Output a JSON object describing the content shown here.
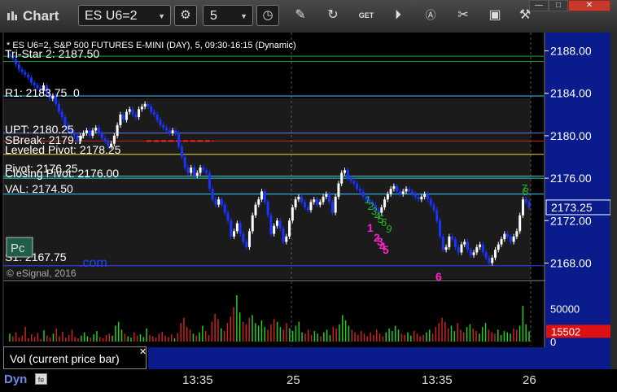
{
  "toolbar": {
    "app_title": "Chart",
    "symbol": "ES U6=2",
    "interval": "5",
    "icons": [
      "link-icon",
      "interval-refresh-icon",
      "clock-icon",
      "pencil-icon",
      "refresh-icon",
      "get-icon",
      "play-icon",
      "auto-icon",
      "tools-icon",
      "message-icon",
      "settings-icon"
    ],
    "window_buttons": [
      "minimize",
      "maximize",
      "close"
    ]
  },
  "chart_header": "* ES U6=2, S&P 500 FUTURES E-MINI (DAY), 5, 09:30-16:15 (Dynamic)",
  "copyright": "© eSignal, 2016",
  "watermark_left": "Pc",
  "watermark_com": ".com",
  "price_axis": {
    "ticks": [
      "2188.00",
      "2184.00",
      "2180.00",
      "2176.00",
      "2172.00",
      "2168.00"
    ],
    "current_price": "2173.25"
  },
  "level_labels": [
    {
      "text": "Tri-Star 2: 2187.50",
      "value": 2187.5,
      "color": "#22aa33"
    },
    {
      "text": "R1: 2183.75",
      "value": 2183.75,
      "color": "#33c8ff"
    },
    {
      "text": "UPT: 2180.25",
      "value": 2180.25,
      "color": "#6677ff"
    },
    {
      "text": "Leveled Pivot: 2178.25",
      "value": 2178.25,
      "color": "#eedd22"
    },
    {
      "text": "Closing Pivot: 2176.00",
      "value": 2176.0,
      "color": "#33c8c8"
    },
    {
      "text": "VAL: 2174.50",
      "value": 2174.5,
      "color": "#33c8ff"
    },
    {
      "text": "S1: 2167.75",
      "value": 2167.75,
      "color": "#3344ff"
    }
  ],
  "overlapped_label_fragments": [
    "0",
    "SBreak: 2179.7",
    "Pivot: 2176.25"
  ],
  "extra_lines": [
    {
      "value": 2187.0,
      "color": "#22aa33"
    },
    {
      "value": 2179.5,
      "color": "#cc2222"
    },
    {
      "value": 2176.2,
      "color": "#33c8c8"
    }
  ],
  "volume_axis": {
    "ticks": [
      "50000",
      "0"
    ],
    "current_volume": "15502"
  },
  "volume_panel_label": "Vol (current price bar)",
  "time_axis": [
    "13:35",
    "25",
    "13:35",
    "26"
  ],
  "bottom_left_label": "Dyn",
  "annotations": {
    "magenta": [
      "1",
      "2",
      "3",
      "4",
      "5",
      "6"
    ],
    "green": [
      "1",
      "2",
      "3",
      "4",
      "5",
      "6",
      "7",
      "8",
      "9"
    ]
  },
  "chart_data": {
    "type": "candlestick",
    "title": "* ES U6=2, S&P 500 FUTURES E-MINI (DAY), 5, 09:30-16:15 (Dynamic)",
    "ylim": [
      2166.5,
      2189.5
    ],
    "volume_ylim": [
      0,
      70000
    ],
    "closes": [
      2187.5,
      2187.25,
      2186.75,
      2186.25,
      2186.0,
      2185.75,
      2185.5,
      2185.0,
      2184.75,
      2184.5,
      2184.25,
      2184.75,
      2184.0,
      2183.5,
      2183.75,
      2183.0,
      2182.25,
      2181.75,
      2181.0,
      2180.5,
      2180.25,
      2180.0,
      2179.5,
      2180.0,
      2180.25,
      2180.5,
      2180.0,
      2180.5,
      2180.75,
      2180.25,
      2179.75,
      2179.5,
      2179.0,
      2179.25,
      2180.0,
      2181.0,
      2182.0,
      2181.5,
      2182.25,
      2182.5,
      2182.0,
      2181.75,
      2182.5,
      2182.75,
      2183.0,
      2182.75,
      2182.25,
      2182.0,
      2181.5,
      2181.0,
      2180.75,
      2180.5,
      2180.25,
      2180.5,
      2180.25,
      2179.0,
      2178.0,
      2177.0,
      2176.5,
      2177.0,
      2176.25,
      2176.5,
      2177.0,
      2176.75,
      2176.5,
      2175.0,
      2174.0,
      2173.5,
      2174.0,
      2173.5,
      2172.75,
      2172.0,
      2170.5,
      2171.0,
      2171.75,
      2170.75,
      2170.0,
      2169.5,
      2171.0,
      2172.5,
      2173.5,
      2174.0,
      2174.75,
      2173.75,
      2172.5,
      2170.75,
      2171.5,
      2172.0,
      2171.25,
      2170.0,
      2170.5,
      2172.0,
      2173.25,
      2174.0,
      2174.25,
      2173.75,
      2173.25,
      2173.0,
      2173.75,
      2174.0,
      2173.5,
      2173.75,
      2174.25,
      2174.5,
      2173.75,
      2172.75,
      2174.25,
      2175.5,
      2176.5,
      2176.75,
      2176.0,
      2175.75,
      2175.5,
      2175.0,
      2174.75,
      2174.25,
      2174.0,
      2173.75,
      2173.5,
      2173.0,
      2172.75,
      2173.25,
      2174.0,
      2174.5,
      2175.0,
      2175.25,
      2174.75,
      2174.5,
      2174.75,
      2175.0,
      2174.75,
      2174.5,
      2174.25,
      2174.0,
      2174.25,
      2174.5,
      2174.0,
      2173.5,
      2173.0,
      2172.0,
      2170.5,
      2169.25,
      2169.5,
      2170.5,
      2170.25,
      2169.5,
      2169.0,
      2169.75,
      2170.0,
      2169.25,
      2168.75,
      2169.0,
      2169.5,
      2169.75,
      2169.0,
      2168.5,
      2168.0,
      2168.5,
      2169.25,
      2169.75,
      2170.25,
      2170.75,
      2170.5,
      2170.0,
      2170.5,
      2171.0,
      2172.5,
      2174.0,
      2173.75,
      2173.25
    ],
    "volumes": [
      12000,
      8000,
      14000,
      6000,
      9000,
      22000,
      5000,
      11000,
      7000,
      13000,
      4000,
      17000,
      9000,
      6000,
      12000,
      20000,
      8000,
      15000,
      6000,
      10000,
      18000,
      7000,
      5000,
      9000,
      14000,
      8000,
      6000,
      11000,
      16000,
      7000,
      5000,
      10000,
      12000,
      9000,
      24000,
      30000,
      18000,
      12000,
      8000,
      6000,
      14000,
      9000,
      11000,
      7000,
      20000,
      10000,
      8000,
      6000,
      12000,
      15000,
      9000,
      7000,
      11000,
      5000,
      13000,
      28000,
      36000,
      22000,
      18000,
      12000,
      9000,
      14000,
      24000,
      16000,
      10000,
      30000,
      42000,
      34000,
      20000,
      16000,
      28000,
      38000,
      52000,
      70000,
      44000,
      30000,
      26000,
      36000,
      40000,
      28000,
      24000,
      32000,
      22000,
      18000,
      26000,
      34000,
      30000,
      22000,
      18000,
      28000,
      20000,
      16000,
      24000,
      30000,
      14000,
      12000,
      18000,
      10000,
      16000,
      12000,
      8000,
      14000,
      18000,
      10000,
      22000,
      20000,
      26000,
      40000,
      32000,
      24000,
      18000,
      14000,
      10000,
      16000,
      12000,
      8000,
      14000,
      10000,
      18000,
      12000,
      8000,
      14000,
      20000,
      16000,
      24000,
      18000,
      12000,
      10000,
      14000,
      9000,
      16000,
      12000,
      8000,
      10000,
      14000,
      18000,
      12000,
      22000,
      28000,
      36000,
      30000,
      20000,
      24000,
      16000,
      28000,
      18000,
      14000,
      22000,
      26000,
      20000,
      16000,
      12000,
      22000,
      28000,
      18000,
      14000,
      12000,
      18000,
      10000,
      16000,
      14000,
      12000,
      20000,
      18000,
      24000,
      54000,
      26000,
      15502
    ]
  }
}
